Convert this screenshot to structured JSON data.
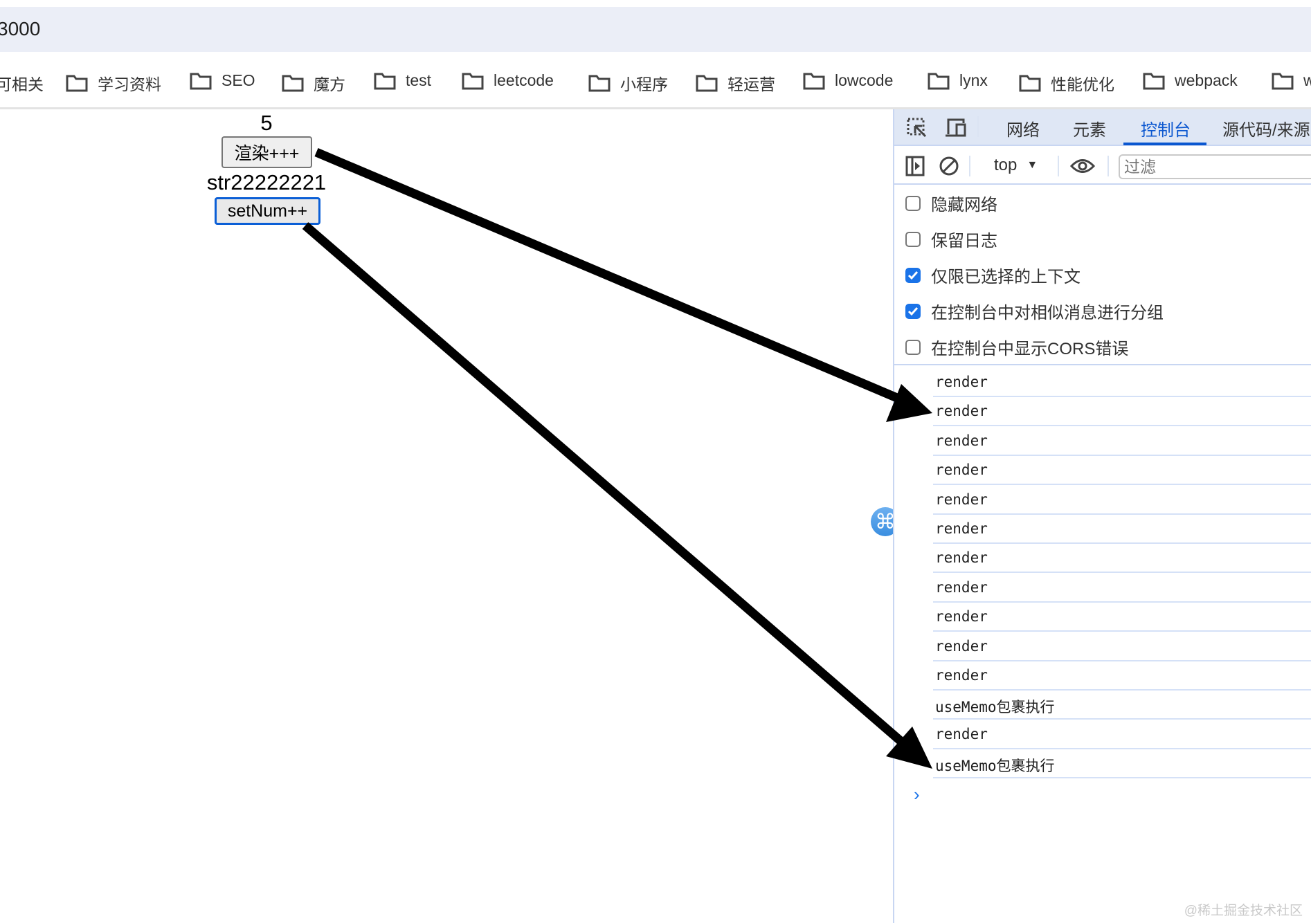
{
  "address_bar": {
    "url_fragment": "3000"
  },
  "bookmarks": [
    "可相关",
    "学习资料",
    "SEO",
    "魔方",
    "test",
    "leetcode",
    "小程序",
    "轻运营",
    "lowcode",
    "lynx",
    "性能优化",
    "webpack",
    "w"
  ],
  "page": {
    "count": "5",
    "render_button": "渲染+++",
    "str_value": "str22222221",
    "setnum_button": "setNum++"
  },
  "devtools": {
    "tabs": [
      "网络",
      "元素",
      "控制台",
      "源代码/来源"
    ],
    "active_tab": "控制台",
    "context": "top",
    "filter_placeholder": "过滤",
    "options": [
      {
        "label": "隐藏网络",
        "checked": false
      },
      {
        "label": "保留日志",
        "checked": false
      },
      {
        "label": "仅限已选择的上下文",
        "checked": true
      },
      {
        "label": "在控制台中对相似消息进行分组",
        "checked": true
      },
      {
        "label": "在控制台中显示CORS错误",
        "checked": false
      }
    ],
    "logs": [
      "render",
      "render",
      "render",
      "render",
      "render",
      "render",
      "render",
      "render",
      "render",
      "render",
      "render",
      "useMemo包裹执行",
      "render",
      "useMemo包裹执行"
    ],
    "prompt": "›"
  },
  "watermark": "@稀土掘金技术社区",
  "colors": {
    "accent": "#0b57d0",
    "checkbox": "#1a73e8"
  }
}
